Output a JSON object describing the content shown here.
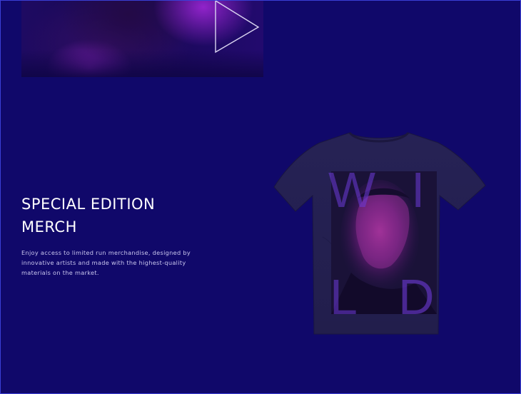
{
  "video": {
    "play_icon": "play-icon"
  },
  "merch": {
    "title_line1": "SPECIAL EDITION",
    "title_line2": "MERCH",
    "description": "Enjoy access to limited run merchandise, designed by innovative artists and made with the highest-quality materials on the market."
  },
  "tshirt": {
    "print_letters": [
      "W",
      "I",
      "L",
      "D"
    ]
  },
  "colors": {
    "background": "#10086a",
    "accent_purple": "#6e3ad8",
    "text": "#ffffff"
  }
}
